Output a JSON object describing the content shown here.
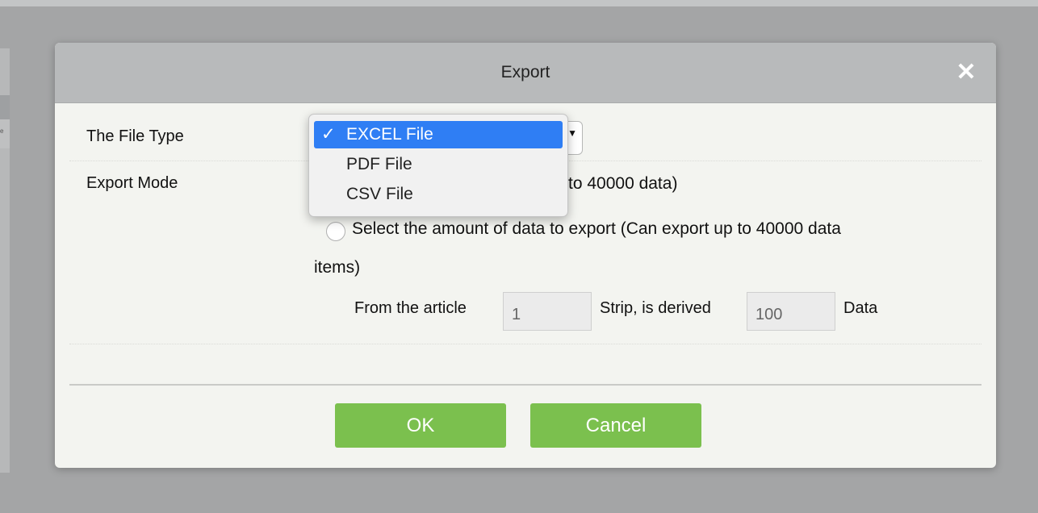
{
  "background": {
    "left_panel_text": "e"
  },
  "dialog": {
    "title": "Export",
    "close_glyph": "✕",
    "file_type_label": "The File Type",
    "export_mode_label": "Export Mode",
    "file_type_select": {
      "selected": "EXCEL File",
      "arrows_glyph": "▲▼",
      "options": [
        {
          "label": "EXCEL File",
          "selected": true,
          "check": "✓"
        },
        {
          "label": "PDF File",
          "selected": false,
          "check": ""
        },
        {
          "label": "CSV File",
          "selected": false,
          "check": ""
        }
      ]
    },
    "mode_all_text_visible": "to 40000 data)",
    "mode_select_amount_text": "Select the amount of data to export (Can export up to 40000 data",
    "mode_select_amount_text_cont": "items)",
    "range": {
      "from_label": "From the article",
      "from_value": "1",
      "strip_label": "Strip, is derived",
      "count_value": "100",
      "data_label": "Data"
    },
    "ok_label": "OK",
    "cancel_label": "Cancel"
  },
  "colors": {
    "button_green": "#7bc04e",
    "selected_blue": "#2f7ef4",
    "header_gray": "#b8babb"
  }
}
